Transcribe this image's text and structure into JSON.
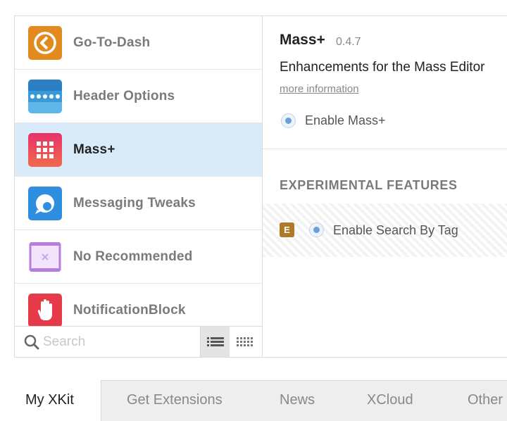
{
  "extensions": [
    {
      "label": "Go-To-Dash",
      "icon": "go-to-dash-icon",
      "color": "#e38a1f"
    },
    {
      "label": "Header Options",
      "icon": "header-options-icon",
      "color": "#3a8fd0"
    },
    {
      "label": "Mass+",
      "icon": "mass-plus-icon",
      "color": "#e8416b",
      "selected": true
    },
    {
      "label": "Messaging Tweaks",
      "icon": "messaging-tweaks-icon",
      "color": "#2f8ee0"
    },
    {
      "label": "No Recommended",
      "icon": "no-recommended-icon",
      "color": "#b57ee0"
    },
    {
      "label": "NotificationBlock",
      "icon": "notification-block-icon",
      "color": "#e53a48"
    }
  ],
  "search": {
    "placeholder": "Search"
  },
  "detail": {
    "title": "Mass+",
    "version": "0.4.7",
    "description": "Enhancements for the Mass Editor",
    "more_info": "more information",
    "enable_label": "Enable Mass+",
    "experimental_heading": "EXPERIMENTAL FEATURES",
    "experimental_badge": "E",
    "experimental_label": "Enable Search By Tag"
  },
  "tabs": [
    {
      "label": "My XKit",
      "active": true
    },
    {
      "label": "Get Extensions"
    },
    {
      "label": "News"
    },
    {
      "label": "XCloud"
    },
    {
      "label": "Other"
    }
  ],
  "colors": {
    "selected_bg": "#d9ebf8",
    "radio_accent": "#6aa0d8",
    "experimental_badge": "#b0792a"
  }
}
